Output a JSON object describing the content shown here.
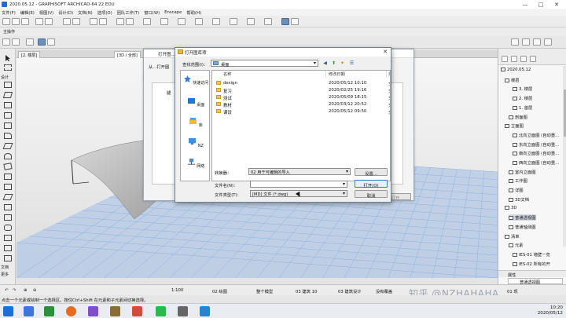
{
  "window": {
    "title": "2020.05.12 - GRAPHISOFT ARCHICAD-64 22 EDU",
    "controls": [
      "—",
      "□",
      "✕"
    ]
  },
  "menu": [
    "文件(F)",
    "编辑(E)",
    "视图(V)",
    "设计(D)",
    "文档(N)",
    "选项(O)",
    "团队工作(T)",
    "窗口(W)",
    "Enscape",
    "帮助(H)"
  ],
  "toolbox": {
    "main_label": "主操作",
    "select_label": "设计",
    "doc_label": "文档",
    "more_label": "更多"
  },
  "tabs": [
    "[2. 楼层]",
    "[3D / 全部]"
  ],
  "behind_window": {
    "title": "打开图...",
    "from_label": "从...打开图",
    "item": "腿",
    "open_btn": "打开"
  },
  "dialog": {
    "title": "打开图库项",
    "close": "✕",
    "look_in_label": "查找范围(I)：",
    "look_in_value": "桌面",
    "places": [
      {
        "label": "快速访问",
        "icon": "quick-access-icon"
      },
      {
        "label": "桌面",
        "icon": "desktop-icon"
      },
      {
        "label": "库",
        "icon": "library-icon"
      },
      {
        "label": "NZ",
        "icon": "computer-icon"
      },
      {
        "label": "网络",
        "icon": "network-icon"
      }
    ],
    "columns": {
      "name": "名称",
      "date": "修改日期",
      "type": "类"
    },
    "files": [
      {
        "name": "design",
        "date": "2020/05/12 10:10",
        "type": "文"
      },
      {
        "name": "复习",
        "date": "2020/02/25 19:16",
        "type": "文"
      },
      {
        "name": "测试",
        "date": "2020/05/09 18:15",
        "type": "文"
      },
      {
        "name": "教材",
        "date": "2020/03/12 20:52",
        "type": "文"
      },
      {
        "name": "课设",
        "date": "2020/05/12 09:50",
        "type": "文"
      }
    ],
    "converter_label": "转换器：",
    "converter_value": "02 用于可编辑的导入",
    "settings_btn": "设置...",
    "filename_label": "文件名(N)：",
    "filename_value": "",
    "filetype_label": "文件类型(T)：",
    "filetype_value": "[MD] 文件 (*.dwg)",
    "open_btn": "打开(O)",
    "cancel_btn": "取消"
  },
  "navigator": {
    "items": [
      {
        "label": "2020.05.12",
        "indent": 0
      },
      {
        "label": "楼层",
        "indent": 1
      },
      {
        "label": "3. 楼层",
        "indent": 3
      },
      {
        "label": "2. 楼层",
        "indent": 3
      },
      {
        "label": "1. 首层",
        "indent": 3
      },
      {
        "label": "剖面图",
        "indent": 2
      },
      {
        "label": "立面图",
        "indent": 1
      },
      {
        "label": "北向立面图 (自动重...",
        "indent": 3
      },
      {
        "label": "东向立面图 (自动重...",
        "indent": 3
      },
      {
        "label": "南向立面图 (自动重...",
        "indent": 3
      },
      {
        "label": "西向立面图 (自动重...",
        "indent": 3
      },
      {
        "label": "室内立面图",
        "indent": 2
      },
      {
        "label": "工作图",
        "indent": 2
      },
      {
        "label": "详图",
        "indent": 2
      },
      {
        "label": "3D文档",
        "indent": 2
      },
      {
        "label": "3D",
        "indent": 1
      },
      {
        "label": "普通透视图",
        "indent": 2,
        "selected": true
      },
      {
        "label": "普通轴测图",
        "indent": 2
      },
      {
        "label": "清单",
        "indent": 1
      },
      {
        "label": "元素",
        "indent": 2
      },
      {
        "label": "IES-01 墙壁一览",
        "indent": 3
      },
      {
        "label": "IES-02 所有的开",
        "indent": 3
      }
    ],
    "properties_label": "属性",
    "properties_value": "普通透视图"
  },
  "bottom": {
    "zoom": "1:100",
    "layer": "02 绘图",
    "model": "整个模型",
    "structure": "03 建筑 10",
    "design": "03 建筑设计",
    "override": "没有覆盖",
    "zero": "01 现"
  },
  "status": "点击一个元素或绘制一个选择区。按住Ctrl+Shift 在元素和子元素间切换选择。",
  "watermark": "知乎 @NZHAHAHA",
  "clock": {
    "time": "10:20",
    "date": "2020/05/12"
  }
}
